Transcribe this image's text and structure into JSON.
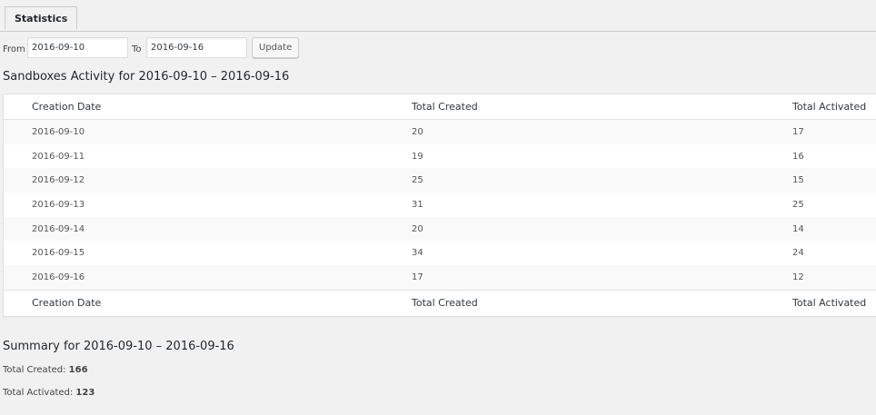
{
  "tab": {
    "label": "Statistics"
  },
  "filter": {
    "from_label": "From",
    "from_value": "2016-09-10",
    "to_label": "To",
    "to_value": "2016-09-16",
    "update_label": "Update"
  },
  "activity": {
    "title": "Sandboxes Activity for 2016-09-10 – 2016-09-16",
    "columns": [
      "Creation Date",
      "Total Created",
      "Total Activated"
    ],
    "rows": [
      [
        "2016-09-10",
        "20",
        "17"
      ],
      [
        "2016-09-11",
        "19",
        "16"
      ],
      [
        "2016-09-12",
        "25",
        "15"
      ],
      [
        "2016-09-13",
        "31",
        "25"
      ],
      [
        "2016-09-14",
        "20",
        "14"
      ],
      [
        "2016-09-15",
        "34",
        "24"
      ],
      [
        "2016-09-16",
        "17",
        "12"
      ]
    ]
  },
  "summary": {
    "title": "Summary for 2016-09-10 – 2016-09-16",
    "created_label": "Total Created:",
    "created_value": "166",
    "activated_label": "Total Activated:",
    "activated_value": "123"
  }
}
